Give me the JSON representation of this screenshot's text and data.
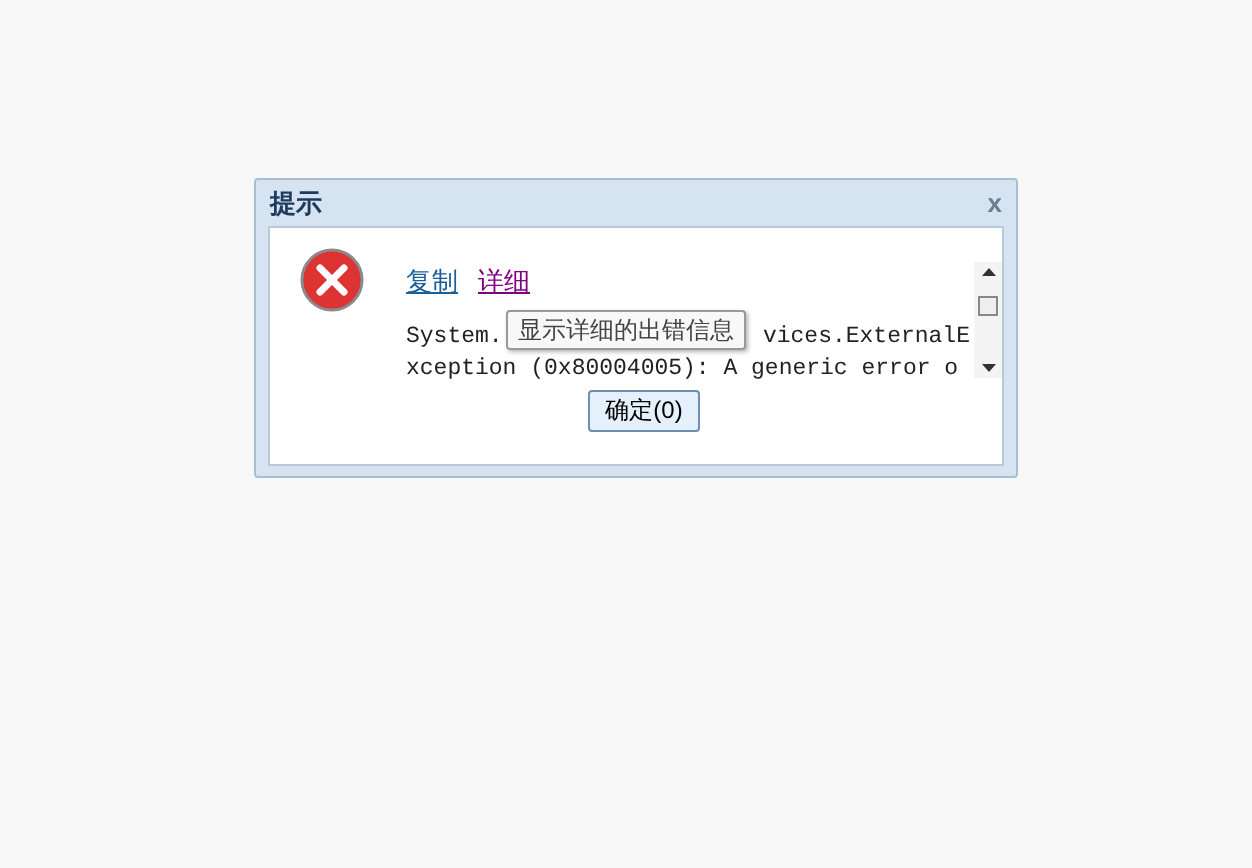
{
  "window": {
    "title": "提示",
    "close": "x"
  },
  "links": [
    {
      "label": "复制",
      "visited": false
    },
    {
      "label": "详细",
      "visited": true
    }
  ],
  "error_lines": [
    {
      "left": "System.",
      "right": "vices.ExternalE"
    },
    {
      "left": "xception (0x80004005): A generic error o"
    }
  ],
  "tooltip": "显示详细的出错信息",
  "ok_button": "确定(0)"
}
